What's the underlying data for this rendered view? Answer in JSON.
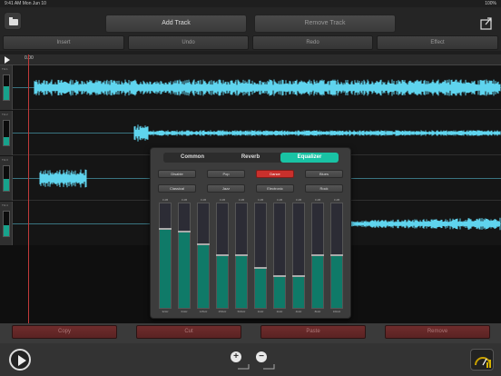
{
  "status": {
    "time": "9:41 AM",
    "date": "Mon Jun 10",
    "battery": "100%"
  },
  "header": {
    "add_track": "Add Track",
    "remove_track": "Remove Track"
  },
  "toolbar": {
    "insert": "Insert",
    "undo": "Undo",
    "redo": "Redo",
    "effect": "Effect"
  },
  "timeline": {
    "start_time": "0.00"
  },
  "tracks": [
    {
      "label": "Trk 1",
      "level": 0.55
    },
    {
      "label": "Trk 2",
      "level": 0.35
    },
    {
      "label": "Trk 3",
      "level": 0.5
    },
    {
      "label": "Trk 4",
      "level": 0.45
    }
  ],
  "equalizer": {
    "tabs": [
      "Common",
      "Reverb",
      "Equalizer"
    ],
    "active_tab": "Equalizer",
    "presets": [
      "Disable",
      "Pop",
      "Dance",
      "Blues",
      "Classical",
      "Jazz",
      "Electronic",
      "Rock"
    ],
    "active_preset": "Dance",
    "bands": [
      {
        "label": "32Hz",
        "value": "0 dB",
        "level": 0.75
      },
      {
        "label": "64Hz",
        "value": "0 dB",
        "level": 0.72
      },
      {
        "label": "125Hz",
        "value": "0 dB",
        "level": 0.6
      },
      {
        "label": "250Hz",
        "value": "0 dB",
        "level": 0.5
      },
      {
        "label": "500Hz",
        "value": "0 dB",
        "level": 0.5
      },
      {
        "label": "1kHz",
        "value": "0 dB",
        "level": 0.37
      },
      {
        "label": "2kHz",
        "value": "0 dB",
        "level": 0.3
      },
      {
        "label": "4kHz",
        "value": "0 dB",
        "level": 0.3
      },
      {
        "label": "8kHz",
        "value": "0 dB",
        "level": 0.5
      },
      {
        "label": "16kHz",
        "value": "0 dB",
        "level": 0.5
      }
    ],
    "colors": {
      "accent": "#19c3a4",
      "active_preset": "#c9302c"
    }
  },
  "edit": {
    "copy": "Copy",
    "cut": "Cut",
    "paste": "Paste",
    "remove": "Remove"
  },
  "colors": {
    "wave": "#5fd4ee",
    "playhead": "#c23a3a"
  }
}
